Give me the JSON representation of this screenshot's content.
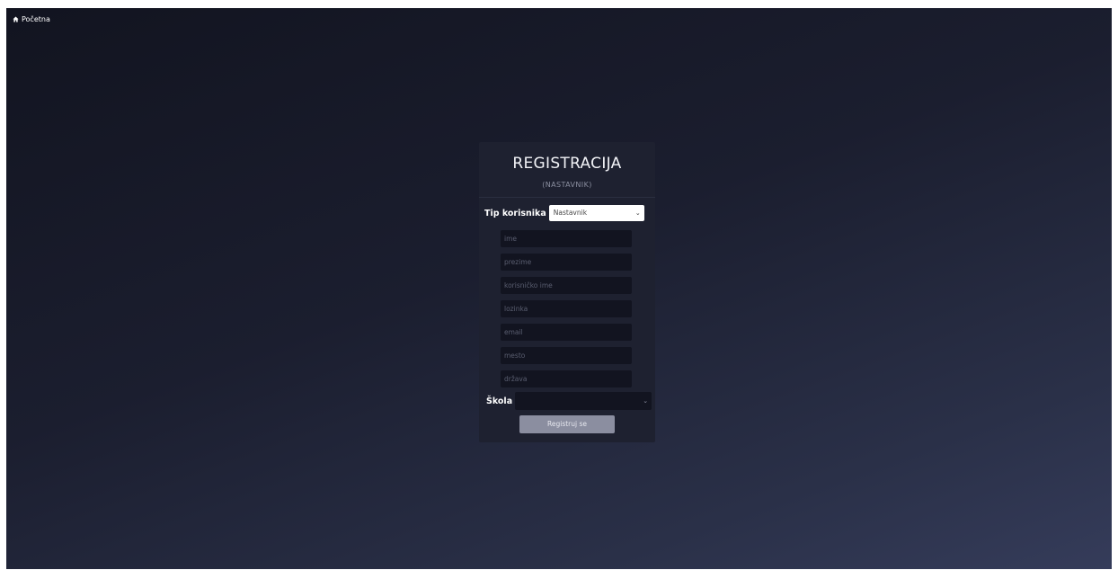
{
  "nav": {
    "home_label": "Početna",
    "home_icon": "home-icon"
  },
  "form": {
    "title": "REGISTRACIJA",
    "subtitle": "(NASTAVNIK)",
    "user_type": {
      "label": "Tip korisnika",
      "selected": "Nastavnik"
    },
    "fields": {
      "first_name_placeholder": "ime",
      "last_name_placeholder": "prezime",
      "username_placeholder": "korisničko ime",
      "password_placeholder": "lozinka",
      "email_placeholder": "email",
      "city_placeholder": "mesto",
      "country_placeholder": "država"
    },
    "school": {
      "label": "Škola",
      "selected": ""
    },
    "submit_label": "Registruj se"
  },
  "colors": {
    "background_top": "#121420",
    "background_bottom": "#353c5a",
    "card": "#1e2130",
    "input": "#121420",
    "button": "#8b8ea0"
  }
}
